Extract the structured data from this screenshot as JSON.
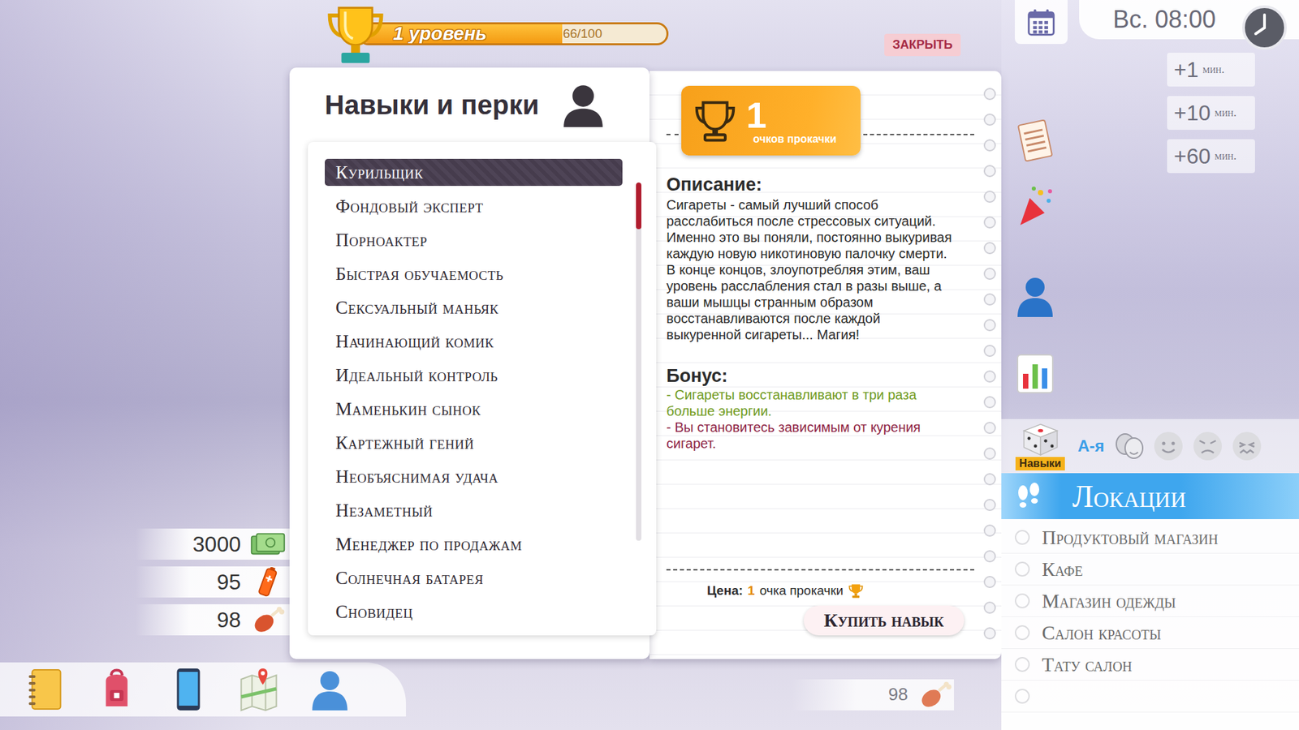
{
  "level": {
    "label": "1 уровень",
    "progress": "66/100",
    "level": 0.66
  },
  "close_button": "ЗАКРЫТЬ",
  "clock": {
    "day_time": "Вс. 08:00"
  },
  "time_buttons": [
    {
      "amount": "+1",
      "unit": "мин."
    },
    {
      "amount": "+10",
      "unit": "мин."
    },
    {
      "amount": "+60",
      "unit": "мин."
    }
  ],
  "panel": {
    "title": "Навыки и перки",
    "skills": [
      {
        "label": "Курильщик",
        "selected": true
      },
      {
        "label": "Фондовый эксперт",
        "selected": false
      },
      {
        "label": "Порноактер",
        "selected": false
      },
      {
        "label": "Быстрая обучаемость",
        "selected": false
      },
      {
        "label": "Сексуальный маньяк",
        "selected": false
      },
      {
        "label": "Начинающий комик",
        "selected": false
      },
      {
        "label": "Идеальный контроль",
        "selected": false
      },
      {
        "label": "Маменькин сынок",
        "selected": false
      },
      {
        "label": "Картежный гений",
        "selected": false
      },
      {
        "label": "Необъяснимая удача",
        "selected": false
      },
      {
        "label": "Незаметный",
        "selected": false
      },
      {
        "label": "Менеджер по продажам",
        "selected": false
      },
      {
        "label": "Солнечная батарея",
        "selected": false
      },
      {
        "label": "Сновидец",
        "selected": false
      }
    ],
    "scrollbar": {
      "level": 0.13
    }
  },
  "points_badge": {
    "value": "1",
    "label": "очков прокачки"
  },
  "description": {
    "title": "Описание:",
    "text": "Сигареты - самый лучший способ расслабиться после стрессовых ситуаций. Именно это вы поняли, постоянно выкуривая каждую новую никотиновую палочку смерти. В конце концов, злоупотребляя этим, ваш уровень расслабления стал в разы выше, а ваши мышцы странным образом восстанавливаются после каждой выкуренной сигареты... Магия!"
  },
  "bonus": {
    "title": "Бонус:",
    "items": [
      {
        "text": "- Сигареты восстанавливают в три раза больше энергии.",
        "color": "#6f9a1c"
      },
      {
        "text": "- Вы становитесь зависимым от курения сигарет.",
        "color": "#8e2444"
      }
    ]
  },
  "price": {
    "label": "Цена:",
    "value": "1",
    "unit": "очка прокачки"
  },
  "buy_button": "Купить навык",
  "stats": [
    {
      "value": "3000",
      "kind": "money"
    },
    {
      "value": "95",
      "kind": "energy"
    },
    {
      "value": "98",
      "kind": "food"
    }
  ],
  "bottom_stat": {
    "value": "98"
  },
  "filters": {
    "skills_tab": {
      "label": "Навыки",
      "selected": true
    },
    "sort_label": "А-я"
  },
  "locations": {
    "title": "Локации",
    "items": [
      {
        "label": "Продуктовый магазин",
        "selected": false
      },
      {
        "label": "Кафе",
        "selected": false
      },
      {
        "label": "Магазин одежды",
        "selected": false
      },
      {
        "label": "Салон красоты",
        "selected": false
      },
      {
        "label": "Тату салон",
        "selected": false
      }
    ]
  }
}
